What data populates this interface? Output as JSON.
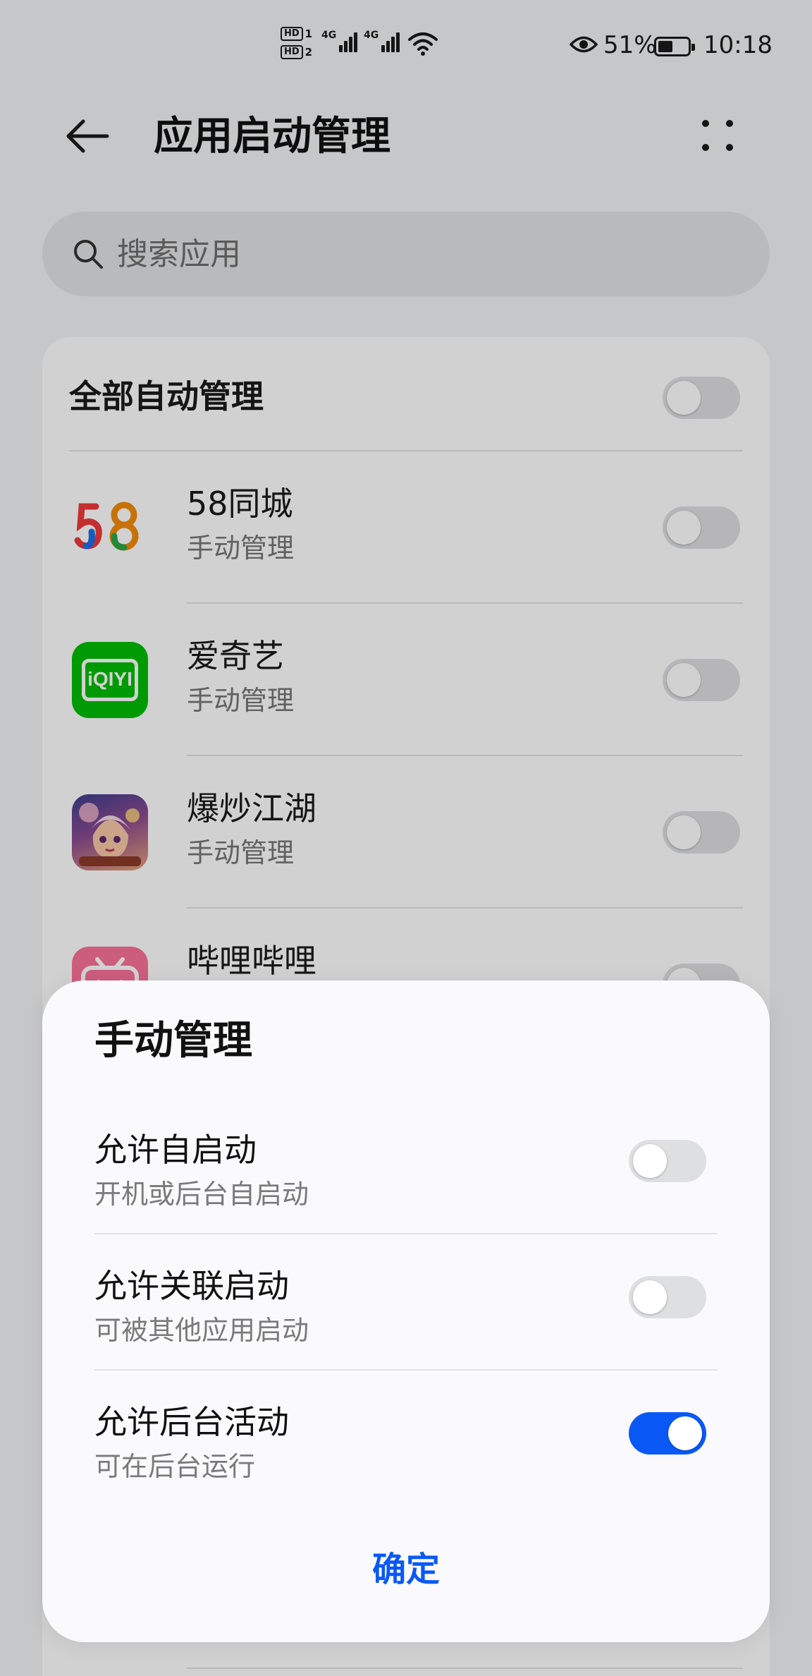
{
  "status_bar": {
    "sim1": "HD",
    "sim1_num": "1",
    "sim2": "HD",
    "sim2_num": "2",
    "network1": "4G",
    "network2": "4G",
    "battery_percent": "51%",
    "battery_level": 0.51,
    "time": "10:18"
  },
  "header": {
    "title": "应用启动管理",
    "back_icon": "back-arrow-icon",
    "more_icon": "more-dots-icon"
  },
  "search": {
    "placeholder": "搜索应用",
    "icon": "search-icon"
  },
  "list": {
    "all_auto_label": "全部自动管理",
    "all_auto_on": false,
    "apps": [
      {
        "name": "58同城",
        "status": "手动管理",
        "enabled": false,
        "icon": "app-58-icon"
      },
      {
        "name": "爱奇艺",
        "status": "手动管理",
        "enabled": false,
        "icon": "app-iqiyi-icon",
        "icon_text": "iQIYI"
      },
      {
        "name": "爆炒江湖",
        "status": "手动管理",
        "enabled": false,
        "icon": "app-baochao-icon"
      },
      {
        "name": "哔哩哔哩",
        "status": "",
        "enabled": false,
        "icon": "app-bilibili-icon"
      }
    ]
  },
  "dialog": {
    "title": "手动管理",
    "options": [
      {
        "label": "允许自启动",
        "desc": "开机或后台自启动",
        "on": false
      },
      {
        "label": "允许关联启动",
        "desc": "可被其他应用启动",
        "on": false
      },
      {
        "label": "允许后台活动",
        "desc": "可在后台运行",
        "on": true
      }
    ],
    "confirm_label": "确定"
  },
  "colors": {
    "accent": "#0a59f7",
    "toggle_off": "#dedfe1",
    "iqiyi_green": "#00be06",
    "bilibili_pink": "#fb7299"
  }
}
